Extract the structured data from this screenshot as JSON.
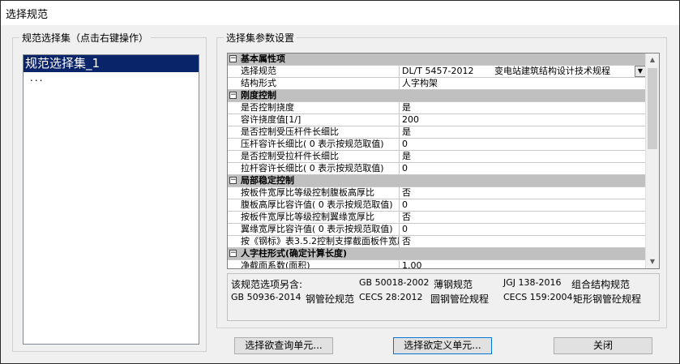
{
  "window": {
    "title": "选择规范"
  },
  "left_panel": {
    "label": "规范选择集（点击右键操作）",
    "items": [
      {
        "label": "规范选择集_1",
        "selected": true
      },
      {
        "label": "...",
        "selected": false
      }
    ]
  },
  "right_panel": {
    "label": "选择集参数设置",
    "grid": {
      "rows": [
        {
          "type": "category",
          "label": "基本属性项",
          "toggle": "⊟"
        },
        {
          "type": "combo",
          "key": "选择规范",
          "code": "DL/T 5457-2012",
          "desc": "变电站建筑结构设计技术规程"
        },
        {
          "type": "prop",
          "key": "结构形式",
          "value": "人字构架"
        },
        {
          "type": "category",
          "label": "刚度控制",
          "toggle": "⊟"
        },
        {
          "type": "prop",
          "key": "是否控制挠度",
          "value": "是"
        },
        {
          "type": "prop",
          "key": "容许挠度值[1/]",
          "value": "200"
        },
        {
          "type": "prop",
          "key": "是否控制受压杆件长细比",
          "value": "是"
        },
        {
          "type": "prop",
          "key": "压杆容许长细比( 0 表示按规范取值)",
          "value": "0"
        },
        {
          "type": "prop",
          "key": "是否控制受拉杆件长细比",
          "value": "是"
        },
        {
          "type": "prop",
          "key": "拉杆容许长细比( 0 表示按规范取值)",
          "value": "0"
        },
        {
          "type": "category",
          "label": "局部稳定控制",
          "toggle": "⊟"
        },
        {
          "type": "prop",
          "key": "按板件宽厚比等级控制腹板高厚比",
          "value": "否"
        },
        {
          "type": "prop",
          "key": "腹板高厚比容许值( 0 表示按规范取值)",
          "value": "0"
        },
        {
          "type": "prop",
          "key": "按板件宽厚比等级控制翼缘宽厚比",
          "value": "否"
        },
        {
          "type": "prop",
          "key": "翼缘宽厚比容许值( 0 表示按规范取值)",
          "value": "0"
        },
        {
          "type": "prop",
          "key": "按《钢标》表3.5.2控制支撑截面板件宽厚比",
          "value": "否"
        },
        {
          "type": "category",
          "label": "人字柱形式(确定计算长度)",
          "toggle": "⊟"
        },
        {
          "type": "prop",
          "key": "净截面系数(面积)",
          "value": "1.00"
        }
      ]
    },
    "info": {
      "heading": "该规范选项另含:",
      "items": [
        {
          "code": "GB 50018-2002",
          "name": "薄钢规范"
        },
        {
          "code": "JGJ 138-2016",
          "name": "组合结构规范"
        },
        {
          "code": "GB 50936-2014",
          "name": "钢管砼规范"
        },
        {
          "code": "CECS 28:2012",
          "name": "圆钢管砼规程"
        },
        {
          "code": "CECS 159:2004",
          "name": "矩形钢管砼规程"
        }
      ]
    }
  },
  "buttons": {
    "query": "选择欲查询单元...",
    "define": "选择欲定义单元...",
    "close": "关闭"
  },
  "icons": {
    "dropdown": "triangle-down-icon",
    "scroll_up": "triangle-up-icon",
    "scroll_down": "triangle-down-icon"
  }
}
